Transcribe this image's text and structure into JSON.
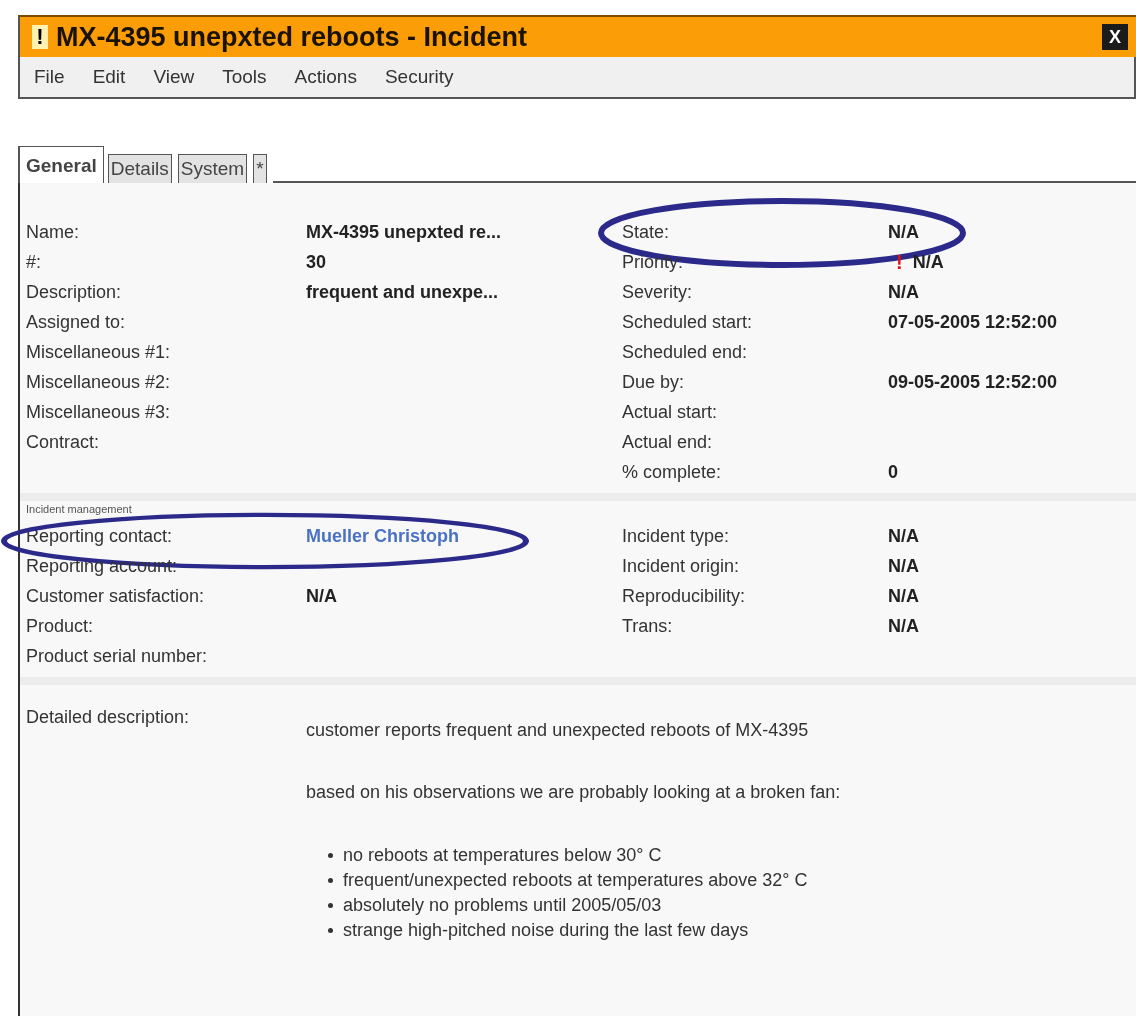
{
  "window": {
    "title": "MX-4395 unepxted reboots - Incident",
    "close": "X",
    "alert": "!"
  },
  "menu": [
    "File",
    "Edit",
    "View",
    "Tools",
    "Actions",
    "Security"
  ],
  "tabs": [
    {
      "label": "General",
      "selected": true
    },
    {
      "label": "Details",
      "selected": false
    },
    {
      "label": "System",
      "selected": false
    },
    {
      "label": "*",
      "selected": false
    }
  ],
  "sections": [
    {
      "left": [
        {
          "label": "Name:",
          "value": "MX-4395 unepxted re..."
        },
        {
          "label": "#:",
          "value": "30"
        },
        {
          "label": "Description:",
          "value": "frequent and unexpe..."
        },
        {
          "label": "Assigned to:"
        },
        {
          "label": "Miscellaneous #1:"
        },
        {
          "label": "Miscellaneous #2:"
        },
        {
          "label": "Miscellaneous #3:"
        },
        {
          "label": "Contract:"
        }
      ],
      "right": [
        {
          "label": "State:",
          "value": "N/A",
          "highlighted": true
        },
        {
          "label": "Priority:",
          "value": "N/A",
          "mark": "!"
        },
        {
          "label": "Severity:",
          "value": "N/A"
        },
        {
          "label": "Scheduled start:",
          "value": "07-05-2005 12:52:00"
        },
        {
          "label": "Scheduled end:"
        },
        {
          "label": "Due by:",
          "value": "09-05-2005 12:52:00"
        },
        {
          "label": "Actual start:"
        },
        {
          "label": "Actual end:"
        },
        {
          "label": "% complete:",
          "value": "0"
        }
      ]
    },
    {
      "label": "Incident management",
      "left": [
        {
          "label": "Reporting contact:",
          "value": "Mueller Christoph",
          "link": true,
          "highlighted": true
        },
        {
          "label": "Reporting account:"
        },
        {
          "label": "Customer satisfaction:",
          "value": "N/A"
        },
        {
          "label": "Product:"
        },
        {
          "label": "Product serial number:"
        }
      ],
      "right": [
        {
          "label": "Incident type:",
          "value": "N/A"
        },
        {
          "label": "Incident origin:",
          "value": "N/A"
        },
        {
          "label": "Reproducibility:",
          "value": "N/A"
        },
        {
          "label": "Trans:",
          "value": "N/A"
        }
      ]
    }
  ],
  "detailed_description": {
    "label": "Detailed description:",
    "paragraphs": [
      "customer reports frequent and unexpected reboots of MX-4395",
      "based on his observations we are probably looking at a broken fan:"
    ],
    "bullets": [
      "no reboots at temperatures below 30° C",
      "frequent/unexpected reboots at temperatures above 32° C",
      "absolutely no problems until 2005/05/03",
      "strange high-pitched noise during the last few days"
    ]
  }
}
